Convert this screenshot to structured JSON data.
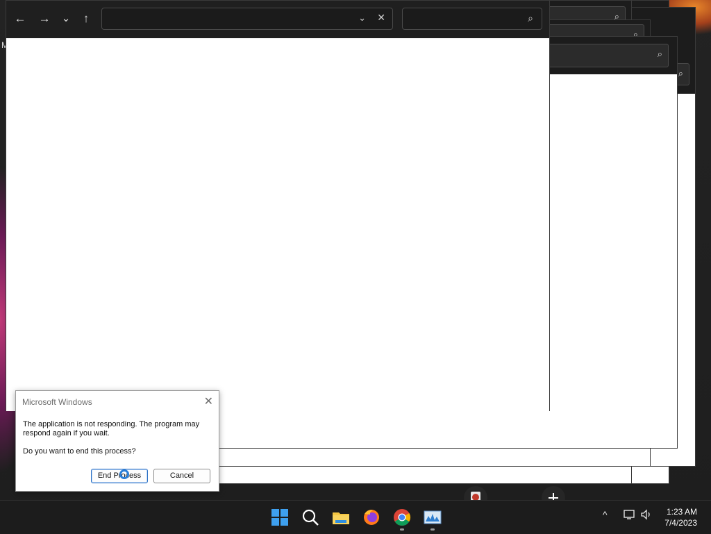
{
  "desktop": {
    "glyph": "M"
  },
  "explorer": {
    "address_value": "",
    "search_placeholder": "",
    "nav": {
      "back_icon": "←",
      "forward_icon": "→",
      "recent_icon": "⌄",
      "up_icon": "↑"
    },
    "address_dropdown_icon": "⌄",
    "address_clear_icon": "✕",
    "search_icon": "⌕"
  },
  "dialog": {
    "title": "Microsoft Windows",
    "message": "The application is not responding. The program may respond again if you wait.",
    "question": "Do you want to end this process?",
    "end_button": "End Process",
    "cancel_button": "Cancel",
    "close_icon": "✕"
  },
  "taskbar": {
    "icons": [
      "windows-start-icon",
      "search-icon",
      "file-explorer-icon",
      "firefox-icon",
      "chrome-icon",
      "performance-monitor-icon"
    ],
    "tray": {
      "chevron": "^",
      "network_icon": "network-icon",
      "volume_icon": "volume-icon"
    },
    "time": "1:23 AM",
    "date": "7/4/2023"
  },
  "colors": {
    "accent": "#2b7fd8",
    "taskbar": "#1c1c1c",
    "explorer_dark": "#1f1f1f"
  }
}
